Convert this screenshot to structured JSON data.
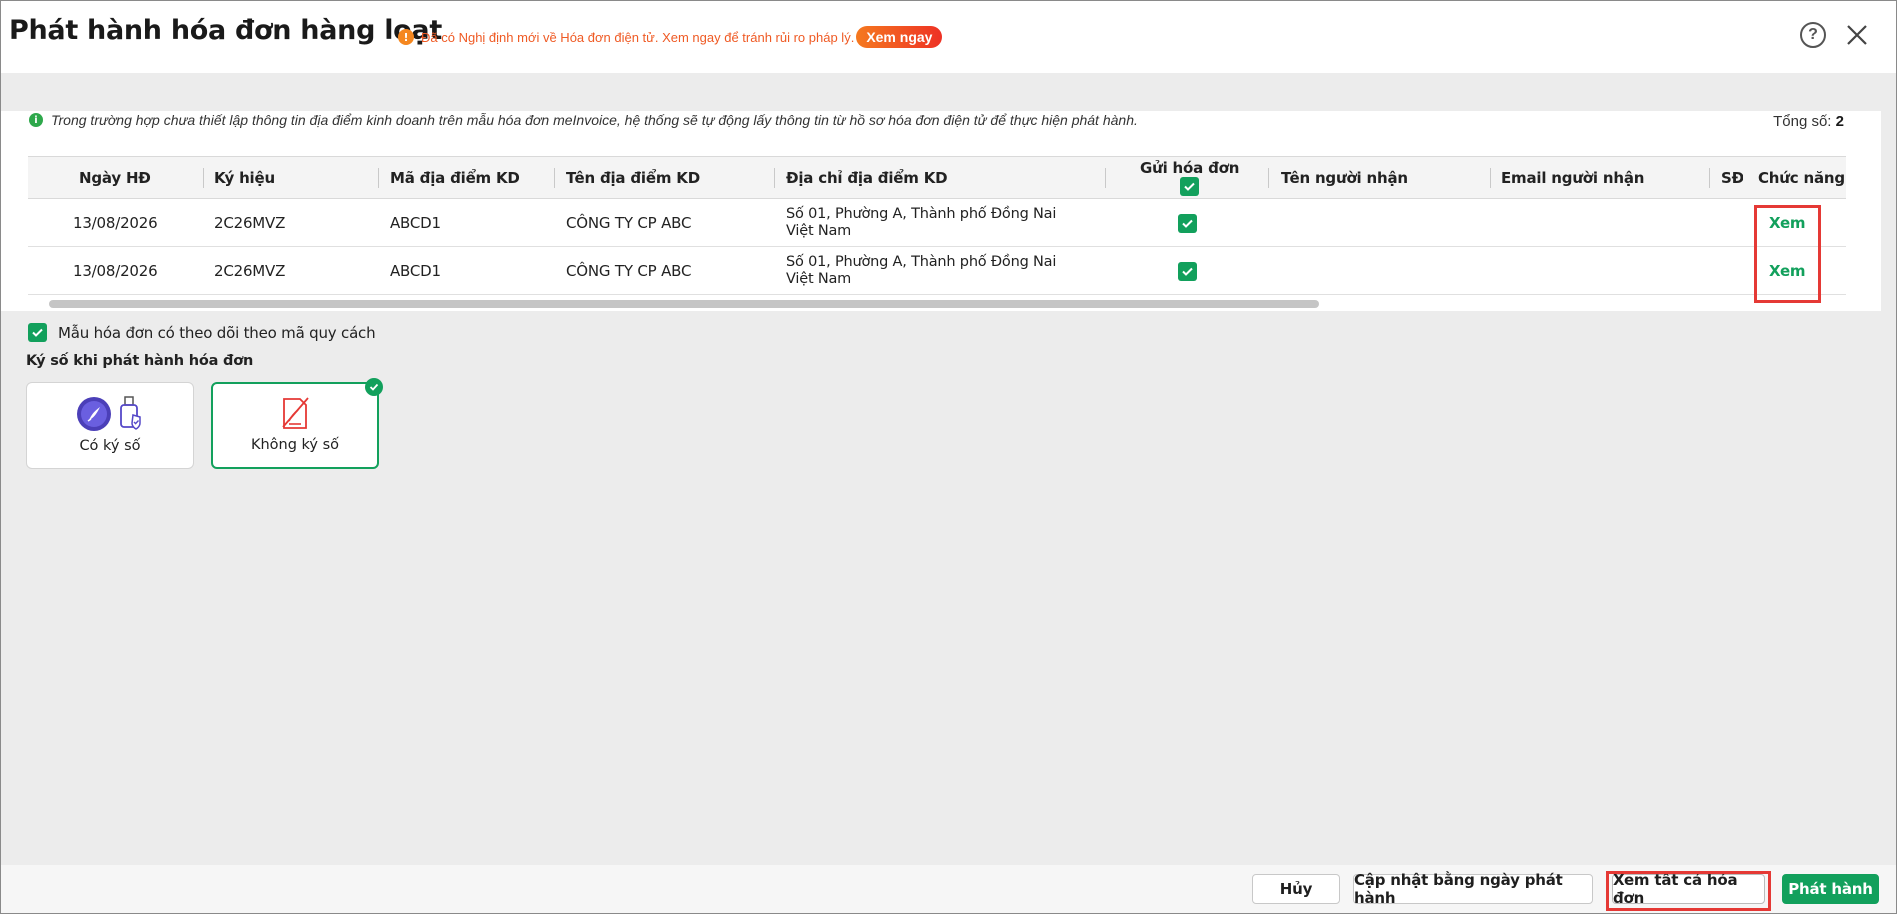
{
  "header": {
    "title": "Phát hành hóa đơn hàng loạt",
    "notice_text": "Đã có Nghị định mới về Hóa đơn điện tử. Xem ngay để tránh rủi ro pháp lý.",
    "notice_button": "Xem ngay"
  },
  "info": {
    "text": "Trong trường hợp chưa thiết lập thông tin địa điểm kinh doanh trên mẫu hóa đơn meInvoice, hệ thống sẽ tự động lấy thông tin từ hồ sơ hóa đơn điện tử để thực hiện phát hành.",
    "total_label": "Tổng số:",
    "total_value": "2"
  },
  "table": {
    "columns": {
      "date": "Ngày HĐ",
      "symbol": "Ký hiệu",
      "loc_code": "Mã địa điểm KD",
      "loc_name": "Tên địa điểm KD",
      "loc_addr": "Địa chỉ địa điểm KD",
      "send": "Gửi hóa đơn",
      "recv_name": "Tên người nhận",
      "recv_email": "Email người nhận",
      "sdt": "SĐ",
      "action": "Chức năng"
    },
    "rows": [
      {
        "date": "13/08/2026",
        "symbol": "2C26MVZ",
        "loc_code": "ABCD1",
        "loc_name": "CÔNG TY CP ABC",
        "loc_addr": "Số 01, Phường A, Thành phố Đồng Nai Việt Nam",
        "action": "Xem"
      },
      {
        "date": "13/08/2026",
        "symbol": "2C26MVZ",
        "loc_code": "ABCD1",
        "loc_name": "CÔNG TY CP ABC",
        "loc_addr": "Số 01, Phường A, Thành phố Đồng Nai Việt Nam",
        "action": "Xem"
      }
    ]
  },
  "options": {
    "track_spec": "Mẫu hóa đơn có theo dõi theo mã quy cách",
    "sign_label": "Ký số khi phát hành hóa đơn",
    "card_sign": "Có ký số",
    "card_nosign": "Không ký số"
  },
  "footer": {
    "cancel": "Hủy",
    "update_date": "Cập nhật bằng ngày phát hành",
    "view_all": "Xem tất cả hóa đơn",
    "publish": "Phát hành"
  },
  "colors": {
    "accent": "#12a05c",
    "notice": "#ef5a24",
    "highlight": "#e53935"
  }
}
